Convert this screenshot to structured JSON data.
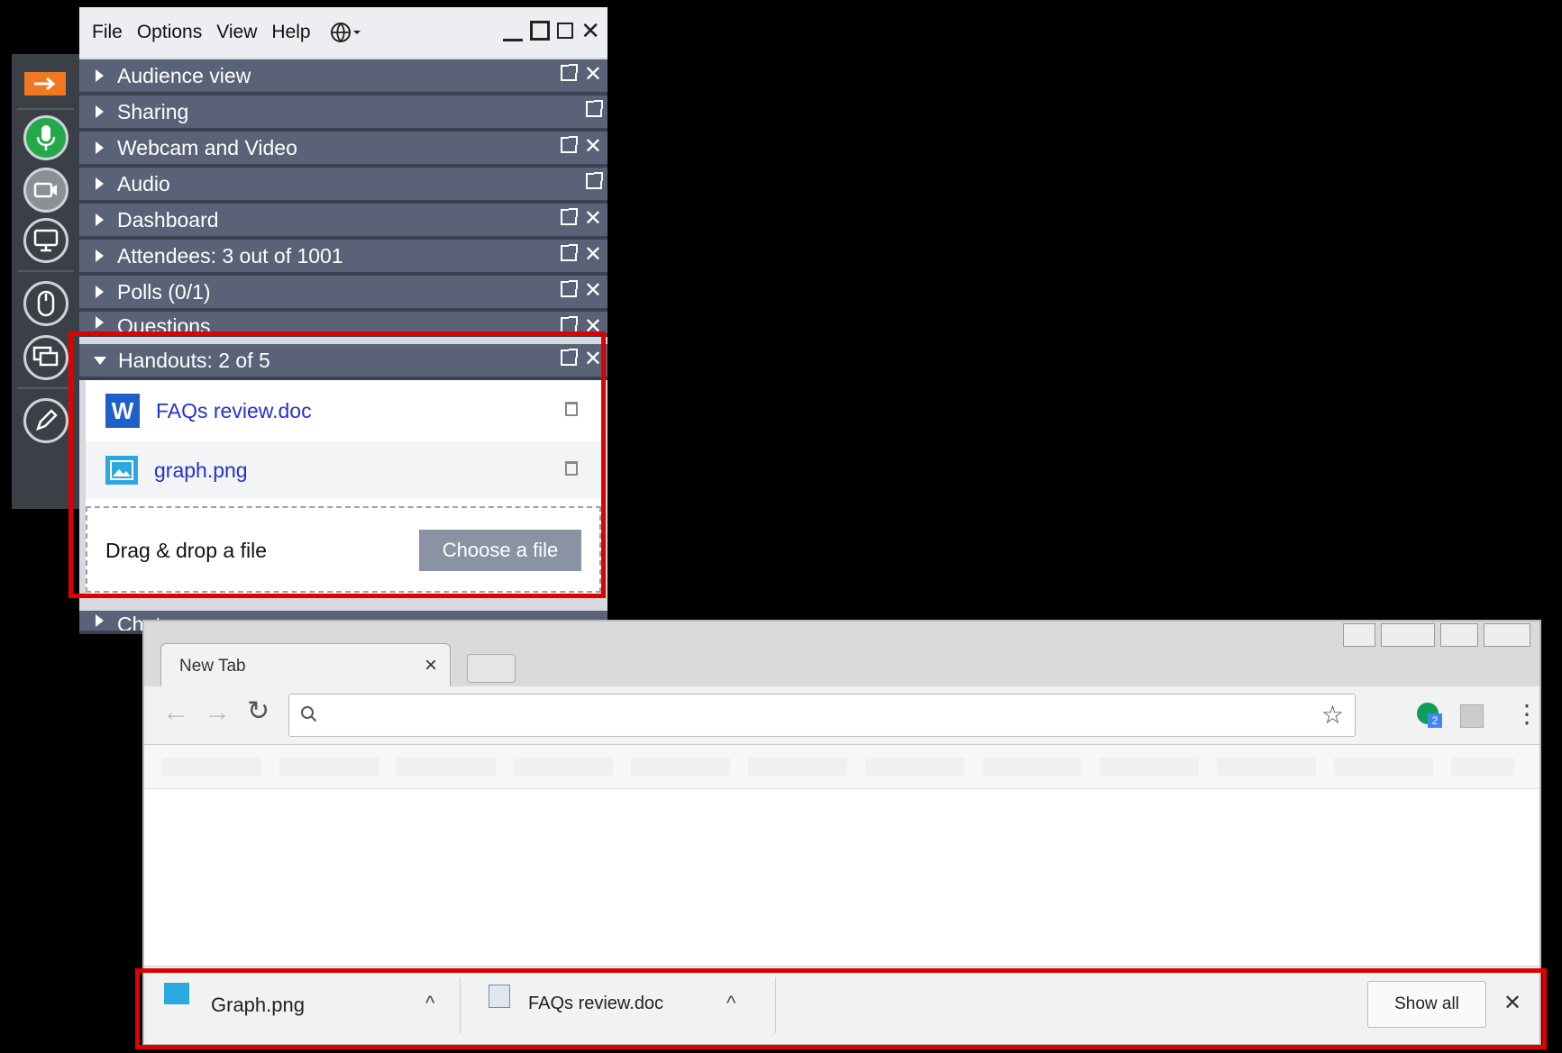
{
  "menu": {
    "file": "File",
    "options": "Options",
    "view": "View",
    "help": "Help"
  },
  "panes": [
    {
      "title": "Audience view",
      "closable": true
    },
    {
      "title": "Sharing",
      "closable": false
    },
    {
      "title": "Webcam and Video",
      "closable": true
    },
    {
      "title": "Audio",
      "closable": false
    },
    {
      "title": "Dashboard",
      "closable": true
    },
    {
      "title": "Attendees:  3 out of 1001",
      "closable": true
    },
    {
      "title": "Polls (0/1)",
      "closable": true
    },
    {
      "title": "Questions",
      "closable": true
    }
  ],
  "handouts": {
    "title": "Handouts: 2 of 5",
    "files": [
      {
        "name": "FAQs review.doc",
        "icon": "word-doc-icon"
      },
      {
        "name": "graph.png",
        "icon": "image-file-icon"
      }
    ],
    "drop_label": "Drag & drop a file",
    "choose_label": "Choose a file"
  },
  "chat_pane": {
    "title": "Chat"
  },
  "browser": {
    "tab_title": "New Tab",
    "tab_close": "×",
    "extension_badge": "2",
    "downloads": [
      {
        "name": "Graph.png",
        "icon": "image-file-icon"
      },
      {
        "name": "FAQs review.doc",
        "icon": "word-doc-icon"
      }
    ],
    "show_all": "Show all",
    "shelf_close": "✕"
  },
  "colors": {
    "pane_header": "#5a6278",
    "highlight": "#e00000",
    "link": "#2233cc",
    "choose_button": "#8a93a4"
  }
}
